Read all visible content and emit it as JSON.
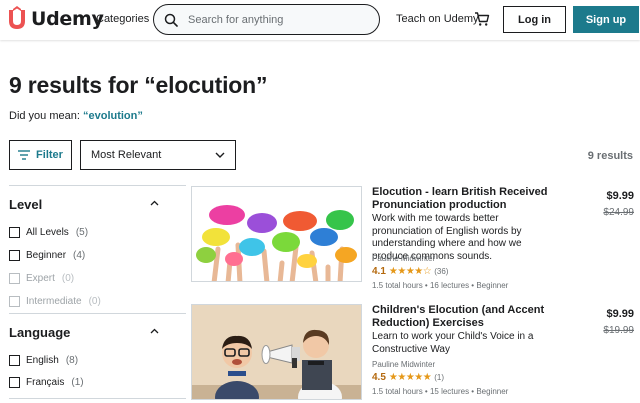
{
  "header": {
    "logo_text": "Udemy",
    "categories_label": "Categories",
    "search_placeholder": "Search for anything",
    "teach_label": "Teach on Udemy",
    "login_label": "Log in",
    "signup_label": "Sign up",
    "brand_color": "#ec5252",
    "accent_color": "#1c7a8c"
  },
  "results": {
    "title": "9 results for “elocution”",
    "did_you_mean_prefix": "Did you mean: ",
    "suggestion": "“evolution”",
    "filter_label": "Filter",
    "sort_value": "Most Relevant",
    "count": "9 results"
  },
  "sidebar": {
    "level": {
      "heading": "Level",
      "options": [
        {
          "label": "All Levels",
          "count": "(5)",
          "disabled": false
        },
        {
          "label": "Beginner",
          "count": "(4)",
          "disabled": false
        },
        {
          "label": "Expert",
          "count": "(0)",
          "disabled": true
        },
        {
          "label": "Intermediate",
          "count": "(0)",
          "disabled": true
        }
      ]
    },
    "language": {
      "heading": "Language",
      "options": [
        {
          "label": "English",
          "count": "(8)",
          "disabled": false
        },
        {
          "label": "Français",
          "count": "(1)",
          "disabled": false
        }
      ]
    }
  },
  "courses": [
    {
      "title": "Elocution - learn British Received Pronunciation production",
      "description": "Work with me towards better pronunciation of English words by understanding where and how we produce commons sounds.",
      "author": "Pauline Midwinter",
      "rating": "4.1",
      "stars": "★★★★☆",
      "reviews": "(36)",
      "meta": "1.5 total hours • 16 lectures • Beginner",
      "price": "$9.99",
      "old_price": "$24.99"
    },
    {
      "title": "Children's Elocution (and Accent Reduction) Exercises",
      "description": "Learn to work your Child's Voice in a Constructive Way",
      "author": "Pauline Midwinter",
      "rating": "4.5",
      "stars": "★★★★★",
      "reviews": "(1)",
      "meta": "1.5 total hours • 15 lectures • Beginner",
      "price": "$9.99",
      "old_price": "$19.99"
    }
  ]
}
